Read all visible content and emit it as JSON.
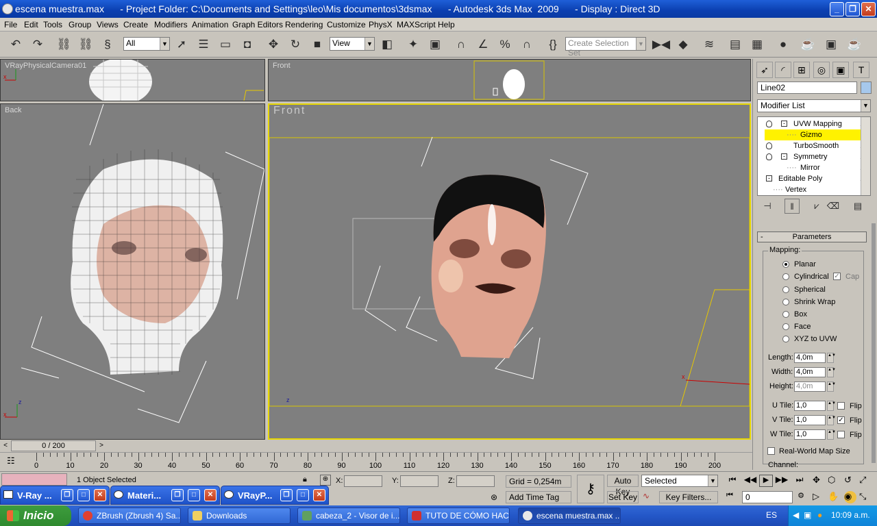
{
  "window": {
    "title": "escena muestra.max      - Project Folder: C:\\Documents and Settings\\leo\\Mis documentos\\3dsmax      - Autodesk 3ds Max  2009      - Display : Direct 3D"
  },
  "menu": [
    "File",
    "Edit",
    "Tools",
    "Group",
    "Views",
    "Create",
    "Modifiers",
    "Animation",
    "Graph Editors",
    "Rendering",
    "Customize",
    "PhysX",
    "MAXScript",
    "Help"
  ],
  "toolbar": {
    "filter_value": "All",
    "refcoord_value": "View",
    "selection_set_placeholder": "Create Selection Set"
  },
  "viewports": {
    "top_left": "VRayPhysicalCamera01",
    "top_right": "Front",
    "back": "Back",
    "front_big": "Front"
  },
  "command_panel": {
    "object_name": "Line02",
    "modifier_list": "Modifier List",
    "stack": [
      {
        "label": "UVW Mapping",
        "level": 0,
        "selected": false,
        "expand": "-"
      },
      {
        "label": "Gizmo",
        "level": 1,
        "selected": true,
        "expand": ""
      },
      {
        "label": "TurboSmooth",
        "level": 0,
        "selected": false,
        "expand": ""
      },
      {
        "label": "Symmetry",
        "level": 0,
        "selected": false,
        "expand": "-"
      },
      {
        "label": "Mirror",
        "level": 1,
        "selected": false,
        "expand": ""
      },
      {
        "label": "Editable Poly",
        "level": 0,
        "selected": false,
        "expand": "-"
      },
      {
        "label": "Vertex",
        "level": 1,
        "selected": false,
        "expand": ""
      }
    ],
    "rollout_title": "Parameters",
    "mapping_group": "Mapping:",
    "mapping_options": [
      "Planar",
      "Cylindrical",
      "Spherical",
      "Shrink Wrap",
      "Box",
      "Face",
      "XYZ to UVW"
    ],
    "mapping_selected": "Planar",
    "cap_label": "Cap",
    "length_label": "Length:",
    "length_value": "4,0m",
    "width_label": "Width:",
    "width_value": "4,0m",
    "height_label": "Height:",
    "height_value": "4,0m",
    "utile_label": "U Tile:",
    "utile_value": "1,0",
    "vtile_label": "V Tile:",
    "vtile_value": "1,0",
    "wtile_label": "W Tile:",
    "wtile_value": "1,0",
    "flip_label": "Flip",
    "realworld_label": "Real-World Map Size",
    "channel_label": "Channel:"
  },
  "timeline": {
    "frame_label": "0 / 200",
    "ticks": [
      "0",
      "10",
      "20",
      "30",
      "40",
      "50",
      "60",
      "70",
      "80",
      "90",
      "100",
      "110",
      "120",
      "130",
      "140",
      "150",
      "160",
      "170",
      "180",
      "190",
      "200"
    ]
  },
  "status": {
    "selection_info": "1 Object Selected",
    "x_label": "X:",
    "y_label": "Y:",
    "z_label": "Z:",
    "grid": "Grid = 0,254m",
    "auto_key": "Auto Key",
    "set_key": "Set Key",
    "key_mode": "Selected",
    "key_filters": "Key Filters...",
    "add_time_tag": "Add Time Tag",
    "current_frame": "0"
  },
  "float_windows": [
    "V-Ray ...",
    "Materi...",
    "VRayP..."
  ],
  "taskbar": {
    "start": "Inicio",
    "tasks": [
      "ZBrush (Zbrush 4) Sa...",
      "Downloads",
      "cabeza_2 - Visor de i...",
      "TUTO DE CÓMO HAC...",
      "escena muestra.max ..."
    ],
    "lang": "ES",
    "clock": "10:09 a.m."
  }
}
